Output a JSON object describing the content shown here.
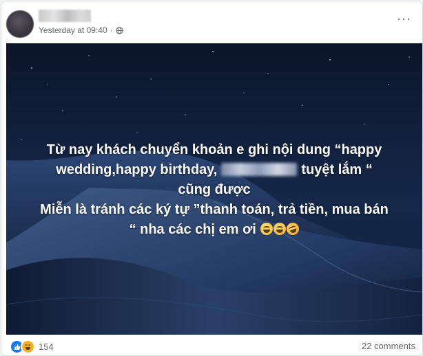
{
  "post": {
    "author_name": "",
    "timestamp": "Yesterday at 09:40",
    "separator": "·",
    "privacy_icon": "globe-icon",
    "more_label": "···"
  },
  "image_text": {
    "line1": "Từ nay khách chuyển khoản e ghi nội dung “happy",
    "line2a": "wedding,happy birthday,",
    "line2b": "tuyệt lắm “",
    "line3": "cũng được",
    "line4": "Miễn là tránh các ký tự ”thanh toán, trả tiền, mua bán",
    "line5": "“ nha các chị em ơi"
  },
  "footer": {
    "reaction_icons": [
      "like-icon",
      "haha-icon"
    ],
    "reaction_count": "154",
    "comments": "22 comments"
  },
  "colors": {
    "like": "#1877f2",
    "haha": "#f7b125",
    "meta_text": "#65676b"
  }
}
